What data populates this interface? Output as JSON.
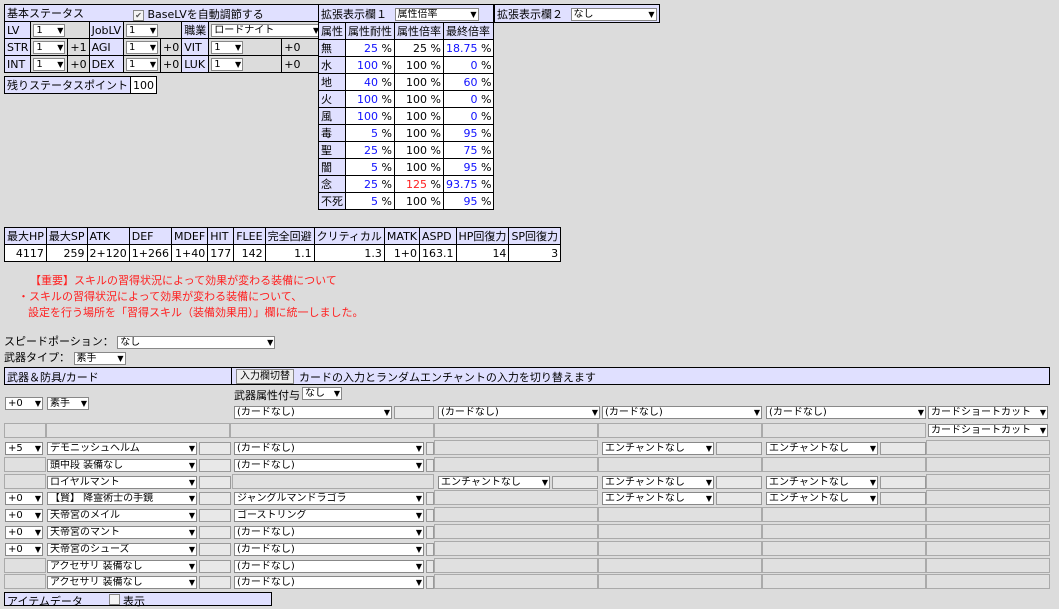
{
  "basic_status": {
    "title": "基本ステータス",
    "autoadjust_label": "BaseLVを自動調節する",
    "lv_label": "LV",
    "lv_value": "1",
    "joblv_label": "JobLV",
    "joblv_value": "1",
    "job_label": "職業",
    "job_value": "ロードナイト",
    "stats": [
      {
        "name": "STR",
        "value": "1",
        "bonus": "+1"
      },
      {
        "name": "AGI",
        "value": "1",
        "bonus": "+0"
      },
      {
        "name": "VIT",
        "value": "1",
        "bonus": "+0"
      },
      {
        "name": "INT",
        "value": "1",
        "bonus": "+0"
      },
      {
        "name": "DEX",
        "value": "1",
        "bonus": "+0"
      },
      {
        "name": "LUK",
        "value": "1",
        "bonus": "+0"
      }
    ],
    "remaining_label": "残りステータスポイント",
    "remaining_value": "100"
  },
  "ext1": {
    "title": "拡張表示欄１",
    "select": "属性倍率",
    "headers": [
      "属性",
      "属性耐性",
      "属性倍率",
      "最終倍率"
    ],
    "rows": [
      {
        "el": "無",
        "res": "25",
        "mult": "25",
        "final": "18.75"
      },
      {
        "el": "水",
        "res": "100",
        "mult": "100",
        "final": "0"
      },
      {
        "el": "地",
        "res": "40",
        "mult": "100",
        "final": "60"
      },
      {
        "el": "火",
        "res": "100",
        "mult": "100",
        "final": "0"
      },
      {
        "el": "風",
        "res": "100",
        "mult": "100",
        "final": "0"
      },
      {
        "el": "毒",
        "res": "5",
        "mult": "100",
        "final": "95"
      },
      {
        "el": "聖",
        "res": "25",
        "mult": "100",
        "final": "75"
      },
      {
        "el": "闇",
        "res": "5",
        "mult": "100",
        "final": "95"
      },
      {
        "el": "念",
        "res": "25",
        "mult": "125",
        "final": "93.75"
      },
      {
        "el": "不死",
        "res": "5",
        "mult": "100",
        "final": "95"
      }
    ],
    "unit": "%"
  },
  "ext2": {
    "title": "拡張表示欄２",
    "select": "なし"
  },
  "summary": {
    "headers": [
      "最大HP",
      "最大SP",
      "ATK",
      "DEF",
      "MDEF",
      "HIT",
      "FLEE",
      "完全回避",
      "クリティカル",
      "MATK",
      "ASPD",
      "HP回復力",
      "SP回復力"
    ],
    "values": [
      "4117",
      "259",
      "2+120",
      "1+266",
      "1+40",
      "177",
      "142",
      "1.1",
      "1.3",
      "1+0",
      "163.1",
      "14",
      "3"
    ]
  },
  "notice": {
    "line1": "【重要】スキルの習得状況によって効果が変わる装備について",
    "line2": "・スキルの習得状況によって効果が変わる装備について、",
    "line3": "設定を行う場所を「習得スキル（装備効果用）」欄に統一しました。"
  },
  "speed_potion": {
    "label": "スピードポーション：",
    "value": "なし"
  },
  "weapon_type": {
    "label": "武器タイプ：",
    "value": "素手"
  },
  "equip": {
    "title": "武器＆防具/カード",
    "toggle_button": "入力欄切替",
    "toggle_desc": "カードの入力とランダムエンチャントの入力を切り替えます",
    "weapon_refine": "+0",
    "weapon_name": "素手",
    "weapon_element_label": "武器属性付与",
    "weapon_element_value": "なし",
    "no_card": "(カードなし)",
    "card_shortcut": "カードショートカット",
    "no_enchant": "エンチャントなし",
    "rows": [
      {
        "refine": "+5",
        "name": "デモニッシュヘルム",
        "card": "(カードなし)",
        "enc": [
          "",
          "エンチャントなし",
          "エンチャントなし"
        ]
      },
      {
        "refine": "",
        "name": "頭中段 装備なし",
        "card": "(カードなし)",
        "enc": [
          "",
          "",
          ""
        ]
      },
      {
        "refine": "",
        "name": "ロイヤルマント",
        "card": "",
        "enc": [
          "エンチャントなし",
          "エンチャントなし",
          "エンチャントなし"
        ]
      },
      {
        "refine": "+0",
        "name": "【賢】 降霊術士の手鏡",
        "card": "ジャングルマンドラゴラ",
        "enc": [
          "",
          "エンチャントなし",
          "エンチャントなし"
        ]
      },
      {
        "refine": "+0",
        "name": "天帝宮のメイル",
        "card": "ゴーストリング",
        "enc": [
          "",
          "",
          ""
        ]
      },
      {
        "refine": "+0",
        "name": "天帝宮のマント",
        "card": "(カードなし)",
        "enc": [
          "",
          "",
          ""
        ]
      },
      {
        "refine": "+0",
        "name": "天帝宮のシューズ",
        "card": "(カードなし)",
        "enc": [
          "",
          "",
          ""
        ]
      },
      {
        "refine": "",
        "name": "アクセサリ 装備なし",
        "card": "(カードなし)",
        "enc": [
          "",
          "",
          ""
        ]
      },
      {
        "refine": "",
        "name": "アクセサリ 装備なし",
        "card": "(カードなし)",
        "enc": [
          "",
          "",
          ""
        ]
      }
    ]
  },
  "item_data": {
    "label": "アイテムデータ",
    "toggle": "表示"
  }
}
